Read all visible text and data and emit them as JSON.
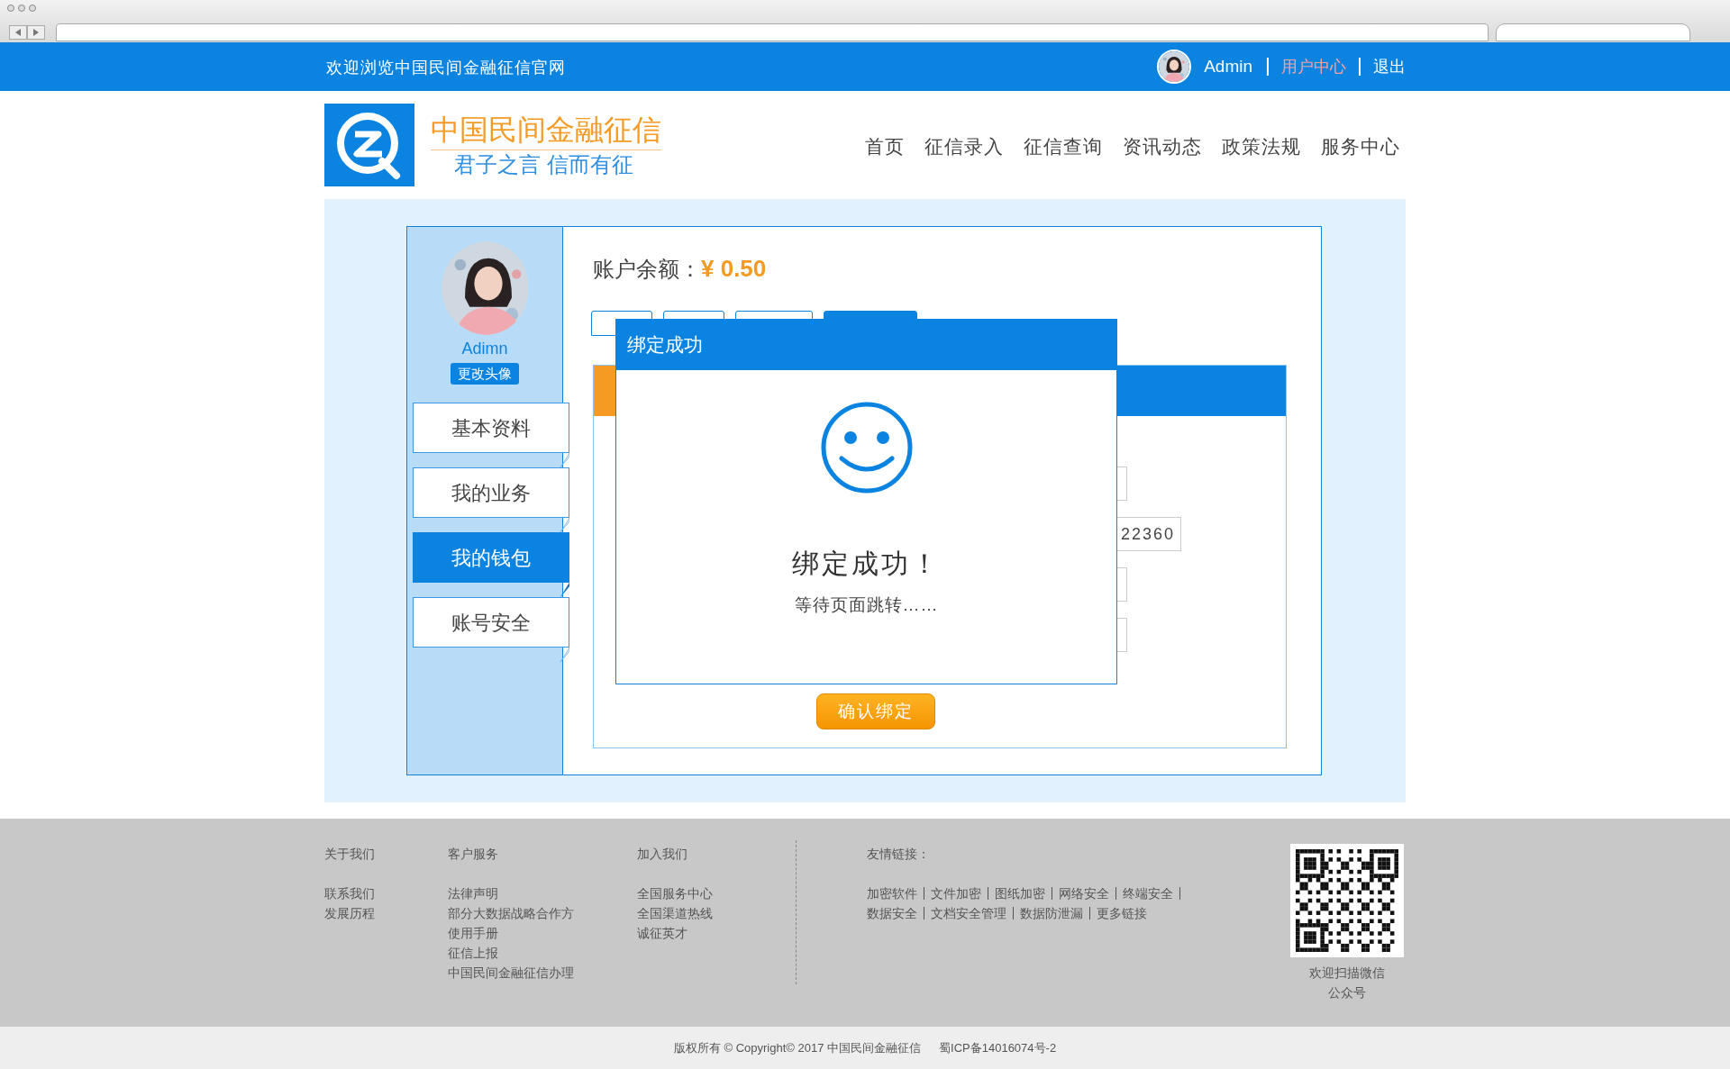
{
  "top_bar": {
    "welcome": "欢迎浏览中国民间金融征信官网",
    "user": "Admin",
    "links": [
      {
        "label": "用户中心",
        "selected": true
      },
      {
        "label": "退出",
        "selected": false
      }
    ]
  },
  "brand": {
    "name": "中国民间金融征信",
    "slogan": "君子之言 信而有征"
  },
  "nav": [
    {
      "label": "首页"
    },
    {
      "label": "征信录入"
    },
    {
      "label": "征信查询"
    },
    {
      "label": "资讯动态"
    },
    {
      "label": "政策法规"
    },
    {
      "label": "服务中心"
    }
  ],
  "profile": {
    "name": "Adimn",
    "change_avatar": "更改头像"
  },
  "sidebar": {
    "items": [
      {
        "label": "基本资料",
        "selected": false
      },
      {
        "label": "我的业务",
        "selected": false
      },
      {
        "label": "我的钱包",
        "selected": true
      },
      {
        "label": "账号安全",
        "selected": false
      }
    ]
  },
  "account": {
    "balance_label": "账户余额：",
    "balance": "¥ 0.50"
  },
  "wallet_tabs": [
    {
      "selected": false
    },
    {
      "selected": false
    },
    {
      "selected": false
    },
    {
      "selected": true
    }
  ],
  "panel": {
    "fields": [
      {
        "kind": "short"
      },
      {
        "kind": "long",
        "value": "22360"
      },
      {
        "kind": "short"
      },
      {
        "kind": "short"
      }
    ],
    "confirm_button": "确认绑定"
  },
  "modal": {
    "title": "绑定成功",
    "message": "绑定成功！",
    "note": "等待页面跳转……"
  },
  "footer": {
    "columns": [
      {
        "heading": "关于我们",
        "links": [
          "联系我们",
          "发展历程"
        ]
      },
      {
        "heading": "客户服务",
        "links": [
          "法律声明",
          "部分大数据战略合作方",
          "使用手册",
          "征信上报",
          "中国民间金融征信办理"
        ]
      },
      {
        "heading": "加入我们",
        "links": [
          "全国服务中心",
          "全国渠道热线",
          "诚征英才"
        ]
      }
    ],
    "friend_links": {
      "heading": "友情链接：",
      "links": [
        "加密软件",
        "文件加密",
        "图纸加密",
        "网络安全",
        "终端安全",
        "数据安全",
        "文档安全管理",
        "数据防泄漏",
        "更多链接"
      ]
    },
    "qr_caption": "欢迎扫描微信公众号"
  },
  "bottom_bar": {
    "copyright": "版权所有 © Copyright© 2017 中国民间金融征信",
    "icp": "蜀ICP备14016074号-2"
  }
}
